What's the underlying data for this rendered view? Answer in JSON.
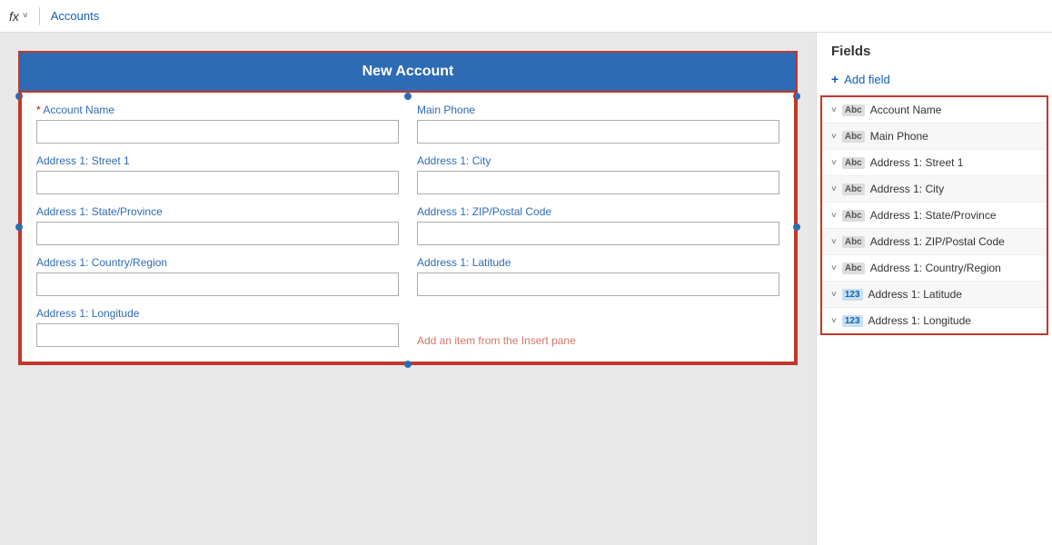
{
  "topBar": {
    "fxLabel": "fx",
    "chevron": "˅",
    "breadcrumb": "Accounts"
  },
  "formHeader": {
    "title": "New Account"
  },
  "formFields": [
    {
      "id": "account-name",
      "label": "Account Name",
      "required": true,
      "col": 1
    },
    {
      "id": "main-phone",
      "label": "Main Phone",
      "required": false,
      "col": 2
    },
    {
      "id": "address-street",
      "label": "Address 1: Street 1",
      "required": false,
      "col": 1
    },
    {
      "id": "address-city",
      "label": "Address 1: City",
      "required": false,
      "col": 2
    },
    {
      "id": "address-state",
      "label": "Address 1: State/Province",
      "required": false,
      "col": 1
    },
    {
      "id": "address-zip",
      "label": "Address 1: ZIP/Postal Code",
      "required": false,
      "col": 2
    },
    {
      "id": "address-country",
      "label": "Address 1: Country/Region",
      "required": false,
      "col": 1
    },
    {
      "id": "address-latitude",
      "label": "Address 1: Latitude",
      "required": false,
      "col": 2
    },
    {
      "id": "address-longitude",
      "label": "Address 1: Longitude",
      "required": false,
      "col": 1
    }
  ],
  "addItemText": "Add an item from the Insert pane",
  "rightPanel": {
    "title": "Fields",
    "addFieldLabel": "Add field",
    "fields": [
      {
        "name": "Account Name",
        "type": "Abc",
        "typeClass": "text"
      },
      {
        "name": "Main Phone",
        "type": "Abc",
        "typeClass": "text"
      },
      {
        "name": "Address 1: Street 1",
        "type": "Abc",
        "typeClass": "text"
      },
      {
        "name": "Address 1: City",
        "type": "Abc",
        "typeClass": "text"
      },
      {
        "name": "Address 1: State/Province",
        "type": "Abc",
        "typeClass": "text"
      },
      {
        "name": "Address 1: ZIP/Postal Code",
        "type": "Abc",
        "typeClass": "text"
      },
      {
        "name": "Address 1: Country/Region",
        "type": "Abc",
        "typeClass": "text"
      },
      {
        "name": "Address 1: Latitude",
        "type": "123",
        "typeClass": "num"
      },
      {
        "name": "Address 1: Longitude",
        "type": "123",
        "typeClass": "num"
      }
    ]
  }
}
